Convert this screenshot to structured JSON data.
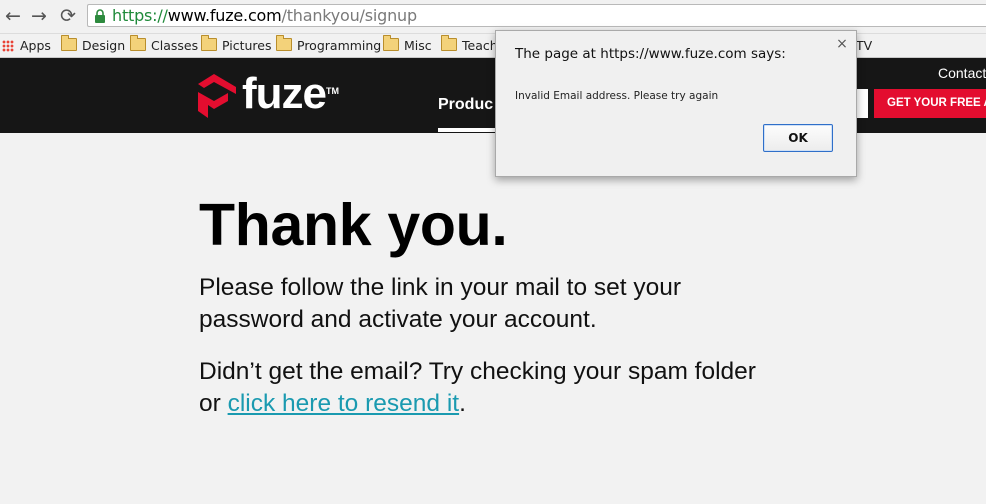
{
  "browser": {
    "url_scheme": "https://",
    "url_host": "www.fuze.com",
    "url_path": "/thankyou/signup",
    "back_icon": "←",
    "forward_icon": "→",
    "reload_icon": "⟳",
    "bookmarks": [
      {
        "label": "Apps",
        "icon": "apps-grid-icon"
      },
      {
        "label": "Design",
        "icon": "folder-icon"
      },
      {
        "label": "Classes",
        "icon": "folder-icon"
      },
      {
        "label": "Pictures",
        "icon": "folder-icon"
      },
      {
        "label": "Programming",
        "icon": "folder-icon"
      },
      {
        "label": "Misc",
        "icon": "folder-icon"
      },
      {
        "label": "Teachi",
        "icon": "folder-icon"
      }
    ],
    "bookmark_overflow_text": "TV"
  },
  "site": {
    "logo_text": "fuze",
    "logo_tm": "TM",
    "nav_products": "Produc",
    "contact": "Contact",
    "cta_label": "GET YOUR FREE A",
    "brand_red": "#e30d2f",
    "header_bg": "#161616"
  },
  "content": {
    "title": "Thank you.",
    "paragraph1": "Please follow the link in your mail to set your password and activate your account.",
    "paragraph2_prefix": "Didn’t get the email? Try checking your spam folder or ",
    "resend_link": "click here to resend it",
    "paragraph2_suffix": "."
  },
  "dialog": {
    "title": "The page at https://www.fuze.com says:",
    "close_icon": "×",
    "message": "Invalid Email address. Please try again",
    "ok_label": "OK"
  }
}
